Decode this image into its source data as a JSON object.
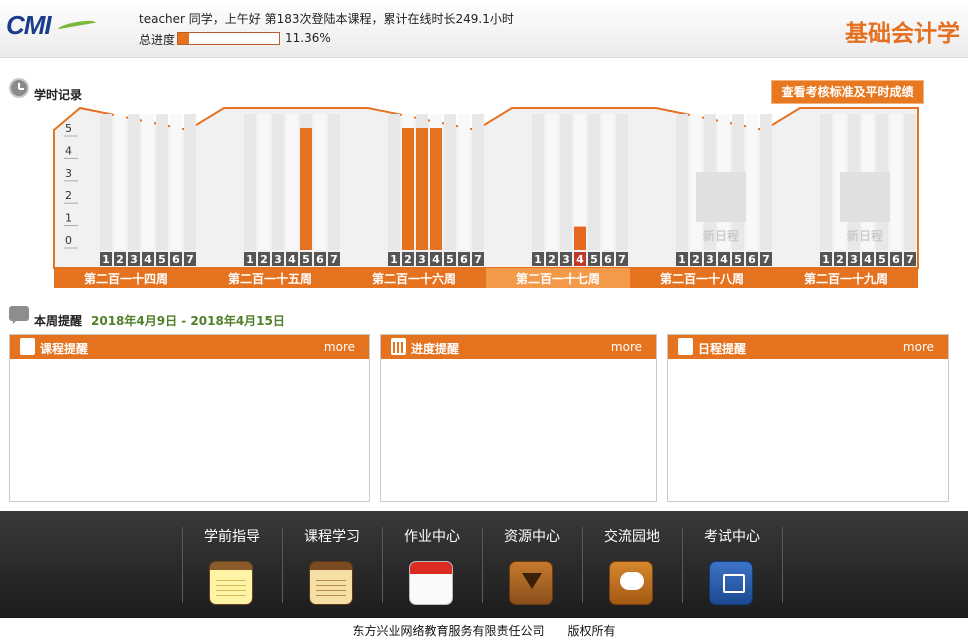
{
  "header": {
    "logo_text": "CMI",
    "greeting": "teacher 同学，上午好 第183次登陆本课程，累计在线时长249.1小时",
    "progress_label": "总进度",
    "progress_fraction": 0.1136,
    "progress_text": "11.36%",
    "course_title": "基础会计学"
  },
  "record": {
    "title": "学时记录",
    "standards_button": "查看考核标准及平时成绩"
  },
  "chart_data": {
    "type": "bar",
    "title": "",
    "ylim": [
      0,
      5
    ],
    "yticks": [
      "0",
      "1",
      "2",
      "3",
      "4",
      "5"
    ],
    "day_labels": [
      "1",
      "2",
      "3",
      "4",
      "5",
      "6",
      "7"
    ],
    "weeks": [
      {
        "label": "第二百一十四周",
        "values": [
          0,
          0,
          0,
          0,
          0,
          0,
          0
        ],
        "current": false,
        "empty_text": ""
      },
      {
        "label": "第二百一十五周",
        "values": [
          0,
          0,
          0,
          0,
          5,
          0,
          0
        ],
        "current": false,
        "empty_text": ""
      },
      {
        "label": "第二百一十六周",
        "values": [
          0,
          5,
          5,
          5,
          0,
          0,
          0
        ],
        "current": false,
        "empty_text": ""
      },
      {
        "label": "第二百一十七周",
        "values": [
          0,
          0,
          0,
          0.6,
          0,
          0,
          0
        ],
        "current": true,
        "today_index": 3,
        "empty_text": ""
      },
      {
        "label": "第二百一十八周",
        "values": [
          0,
          0,
          0,
          0,
          0,
          0,
          0
        ],
        "current": false,
        "empty_text": "新日程"
      },
      {
        "label": "第二百一十九周",
        "values": [
          0,
          0,
          0,
          0,
          0,
          0,
          0
        ],
        "current": false,
        "empty_text": "新日程"
      }
    ]
  },
  "weekly": {
    "title": "本周提醒",
    "dates": "2018年4月9日 - 2018年4月15日",
    "panels": [
      {
        "title": "课程提醒",
        "more": "more"
      },
      {
        "title": "进度提醒",
        "more": "more"
      },
      {
        "title": "日程提醒",
        "more": "more"
      }
    ]
  },
  "nav": [
    {
      "label": "学前指导",
      "icon": "notepad-icon"
    },
    {
      "label": "课程学习",
      "icon": "book-icon"
    },
    {
      "label": "作业中心",
      "icon": "calendar-icon"
    },
    {
      "label": "资源中心",
      "icon": "download-icon"
    },
    {
      "label": "交流园地",
      "icon": "chat-icon"
    },
    {
      "label": "考试中心",
      "icon": "exam-icon"
    }
  ],
  "footer": {
    "company": "东方兴业网络教育服务有限责任公司",
    "rights": "版权所有"
  },
  "colors": {
    "accent": "#e5721f",
    "accent_light": "#f39a4a",
    "today": "#c0392b"
  }
}
